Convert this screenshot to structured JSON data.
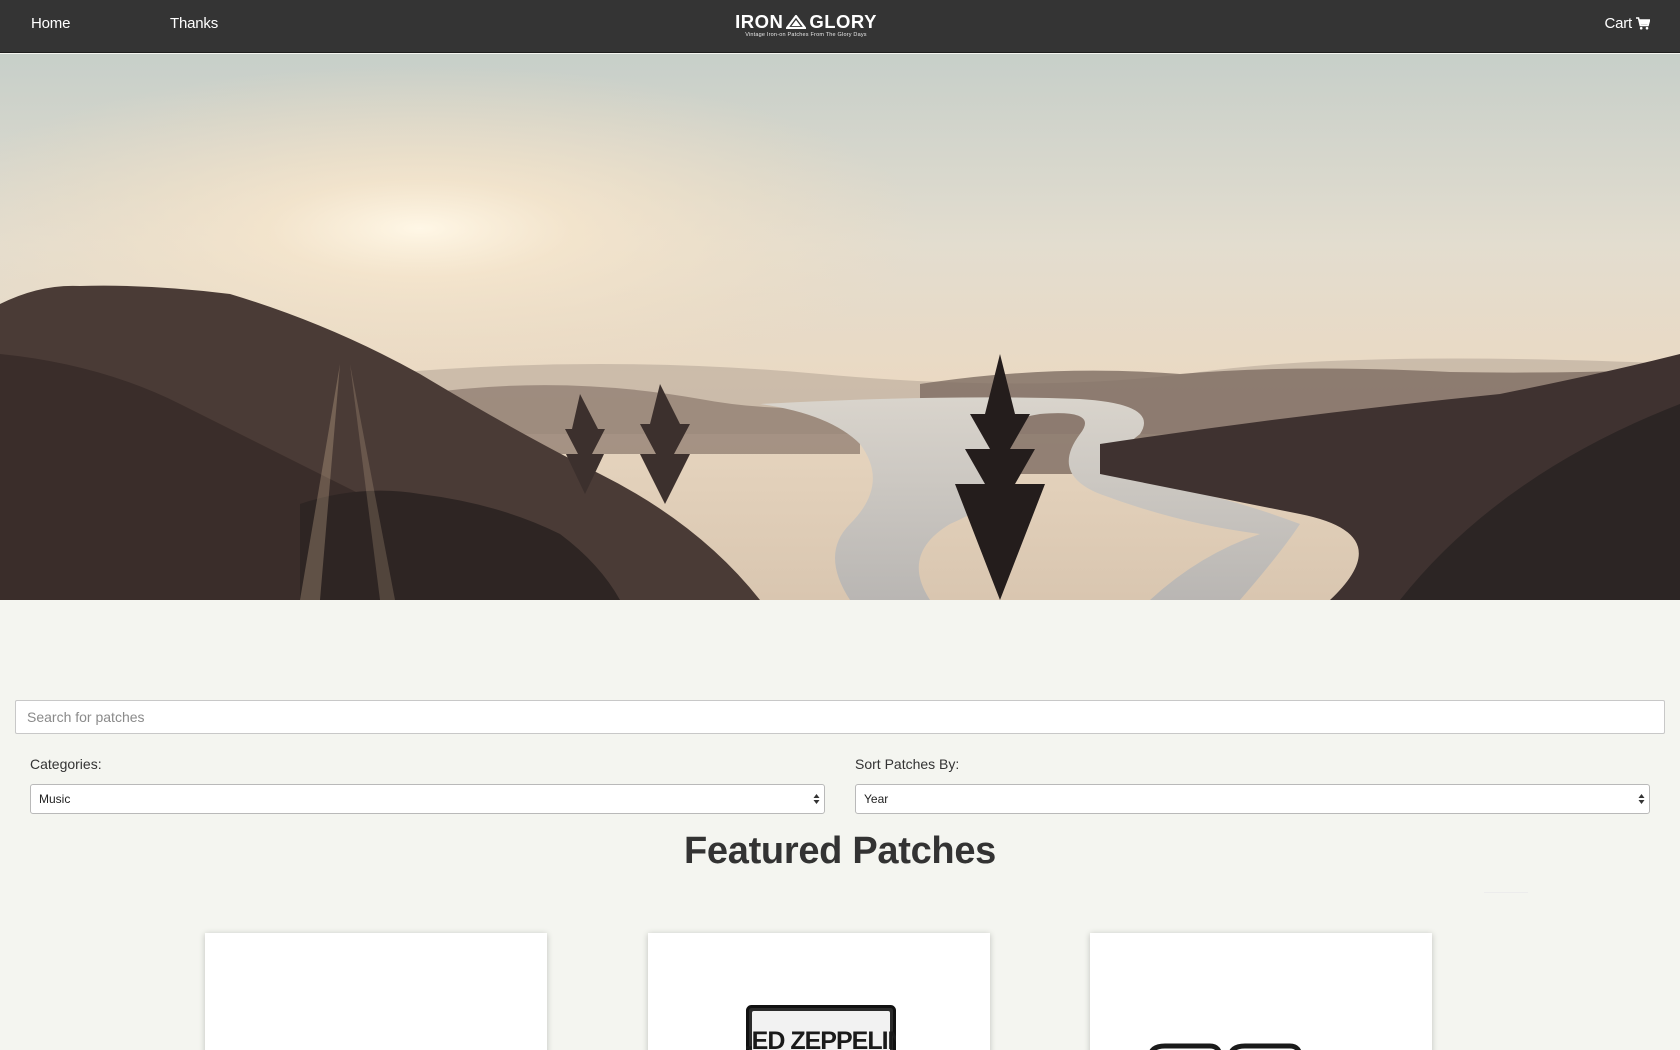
{
  "nav": {
    "home_label": "Home",
    "thanks_label": "Thanks",
    "cart_label": "Cart",
    "cart_icon": "shopping-cart-icon"
  },
  "logo": {
    "word_left": "IRON",
    "word_right": "GLORY",
    "tagline": "Vintage Iron-on Patches From The Glory Days"
  },
  "search": {
    "placeholder": "Search for patches",
    "value": ""
  },
  "filters": {
    "categories_label": "Categories:",
    "categories_selected": "Music",
    "sort_label": "Sort Patches By:",
    "sort_selected": "Year"
  },
  "featured": {
    "title": "Featured Patches"
  },
  "products": [
    {
      "image_icon": "round-patch-icon"
    },
    {
      "image_text": "LED ZEPPELIN",
      "image_icon": "led-zeppelin-patch-icon"
    },
    {
      "image_icon": "sunglasses-patch-icon"
    }
  ],
  "colors": {
    "navbar": "#343434",
    "page_background": "#f4f5f0",
    "card_background": "#ffffff"
  }
}
